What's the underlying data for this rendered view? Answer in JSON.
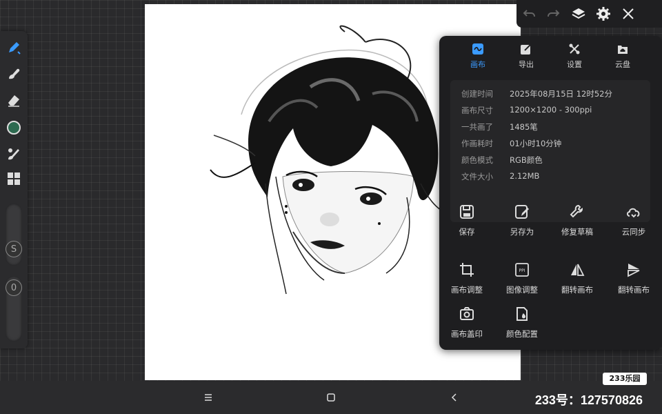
{
  "app": {
    "accent": "#3b9bff",
    "color_swatch": "#2d6a50"
  },
  "toolbar": {
    "tools": [
      "pen-icon",
      "smudge-icon",
      "eraser-icon",
      "color-swatch",
      "brush-library-icon",
      "grid-icon"
    ],
    "size_label": "S",
    "opacity_label": "0"
  },
  "topbar": {
    "icons": [
      "undo-icon",
      "redo-icon",
      "layers-icon",
      "settings-icon",
      "close-icon"
    ]
  },
  "panel": {
    "tabs": [
      {
        "label": "画布",
        "icon": "canvas-icon",
        "active": true
      },
      {
        "label": "导出",
        "icon": "export-icon",
        "active": false
      },
      {
        "label": "设置",
        "icon": "settings-tools-icon",
        "active": false
      },
      {
        "label": "云盘",
        "icon": "cloud-drive-icon",
        "active": false
      }
    ],
    "info": [
      {
        "key": "创建时间",
        "value": "2025年08月15日 12时52分"
      },
      {
        "key": "画布尺寸",
        "value": "1200×1200 - 300ppi"
      },
      {
        "key": "一共画了",
        "value": "1485笔"
      },
      {
        "key": "作画耗时",
        "value": "01小时10分钟"
      },
      {
        "key": "颜色模式",
        "value": "RGB颜色"
      },
      {
        "key": "文件大小",
        "value": "2.12MB"
      }
    ],
    "actions": [
      {
        "label": "保存",
        "icon": "save-icon"
      },
      {
        "label": "另存为",
        "icon": "save-as-icon"
      },
      {
        "label": "修复草稿",
        "icon": "repair-icon"
      },
      {
        "label": "云同步",
        "icon": "cloud-sync-icon"
      },
      {
        "label": "画布调整",
        "icon": "crop-icon"
      },
      {
        "label": "图像调整",
        "icon": "ppi-icon"
      },
      {
        "label": "翻转画布",
        "icon": "flip-horizontal-icon"
      },
      {
        "label": "翻转画布",
        "icon": "flip-vertical-icon"
      },
      {
        "label": "画布盖印",
        "icon": "stamp-camera-icon"
      },
      {
        "label": "颜色配置",
        "icon": "color-profile-icon"
      }
    ]
  },
  "bottom": {
    "nav_icons": [
      "menu-icon",
      "home-icon",
      "back-icon"
    ],
    "watermark": "233乐园",
    "account": "233号：127570826"
  }
}
